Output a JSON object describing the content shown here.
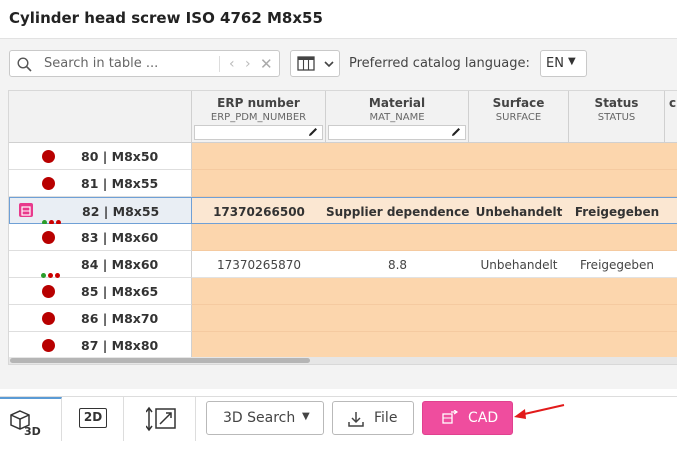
{
  "window": {
    "title": "Cylinder head screw ISO 4762 M8x55"
  },
  "toolbar": {
    "search_placeholder": "Search in table ...",
    "prev_icon": "chevron-left-icon",
    "next_icon": "chevron-right-icon",
    "clear_icon": "close-icon",
    "columns_icon": "table-columns-icon",
    "language_label": "Preferred catalog language:",
    "language_value": "EN"
  },
  "table": {
    "columns": [
      {
        "label": "ERP number",
        "sub": "ERP_PDM_NUMBER",
        "editable": true
      },
      {
        "label": "Material",
        "sub": "MAT_NAME",
        "editable": true
      },
      {
        "label": "Surface",
        "sub": "SURFACE",
        "editable": false
      },
      {
        "label": "Status",
        "sub": "STATUS",
        "editable": false
      },
      {
        "label": "cu",
        "sub": "",
        "editable": false
      }
    ],
    "rows": [
      {
        "label": "80 | M8x50",
        "indicator": "red",
        "erp": "",
        "material": "",
        "surface": "",
        "status": ""
      },
      {
        "label": "81 | M8x55",
        "indicator": "red",
        "erp": "",
        "material": "",
        "surface": "",
        "status": ""
      },
      {
        "label": "82 | M8x55",
        "indicator": "traffic",
        "selected": true,
        "erp": "17370266500",
        "material": "Supplier dependence",
        "surface": "Unbehandelt",
        "status": "Freigegeben"
      },
      {
        "label": "83 | M8x60",
        "indicator": "red",
        "erp": "",
        "material": "",
        "surface": "",
        "status": ""
      },
      {
        "label": "84 | M8x60",
        "indicator": "traffic",
        "white": true,
        "erp": "17370265870",
        "material": "8.8",
        "surface": "Unbehandelt",
        "status": "Freigegeben"
      },
      {
        "label": "85 | M8x65",
        "indicator": "red",
        "erp": "",
        "material": "",
        "surface": "",
        "status": ""
      },
      {
        "label": "86 | M8x70",
        "indicator": "red",
        "erp": "",
        "material": "",
        "surface": "",
        "status": ""
      },
      {
        "label": "87 | M8x80",
        "indicator": "red",
        "erp": "",
        "material": "",
        "surface": "",
        "status": ""
      }
    ]
  },
  "bottom": {
    "tab_3d_label": "3D",
    "tab_2d_label": "2D",
    "search3d_label": "3D Search",
    "file_label": "File",
    "cad_label": "CAD"
  },
  "colors": {
    "accent_pink": "#ef4d9e",
    "row_orange": "#fcd6ad",
    "indicator_red": "#b80000",
    "arrow_red": "#e21b1b",
    "selection_blue": "#6fa0d6"
  }
}
